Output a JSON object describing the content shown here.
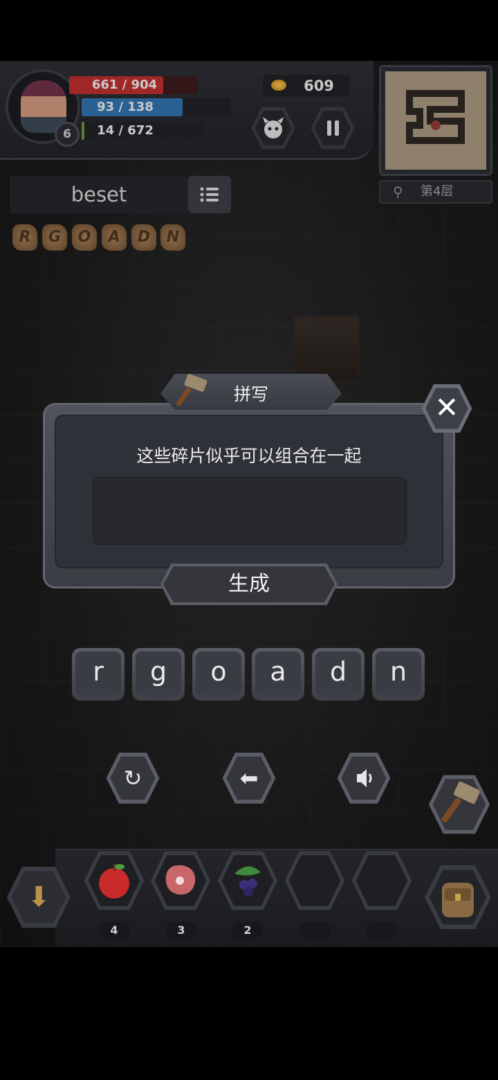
{
  "hud": {
    "level": "6",
    "hp": {
      "text": "661 / 904",
      "current": 661,
      "max": 904,
      "color": "#b52d2d"
    },
    "mp": {
      "text": "93 / 138",
      "current": 93,
      "max": 138,
      "color": "#2f6fa8"
    },
    "xp": {
      "text": "14 / 672",
      "current": 14,
      "max": 672
    },
    "gold": "609",
    "floor": "第4层",
    "buttons": {
      "pet_icon": "demon-face-icon",
      "pause_icon": "pause-icon"
    }
  },
  "word_panel": {
    "current_word": "beset",
    "list_icon": "list-icon",
    "fragments": [
      "R",
      "G",
      "O",
      "A",
      "D",
      "N"
    ]
  },
  "dialog": {
    "title": "拼写",
    "message": "这些碎片似乎可以组合在一起",
    "input_value": "",
    "generate_label": "生成",
    "close_icon": "close-icon"
  },
  "letters": [
    "r",
    "g",
    "o",
    "a",
    "d",
    "n"
  ],
  "controls": {
    "reset_icon": "refresh-icon",
    "back_icon": "arrow-left-icon",
    "sound_icon": "speaker-icon",
    "hammer_icon": "hammer-icon"
  },
  "inventory": {
    "slots": [
      {
        "icon": "apple-icon",
        "count": "4"
      },
      {
        "icon": "meat-icon",
        "count": "3"
      },
      {
        "icon": "berries-icon",
        "count": "2"
      },
      {
        "icon": "",
        "count": ""
      },
      {
        "icon": "",
        "count": ""
      }
    ],
    "bag_icon": "backpack-icon",
    "drop_icon": "arrow-down-icon"
  },
  "colors": {
    "accent_gold": "#b8944a",
    "panel": "#3a3c43",
    "minimap_paper": "#a3927a"
  }
}
